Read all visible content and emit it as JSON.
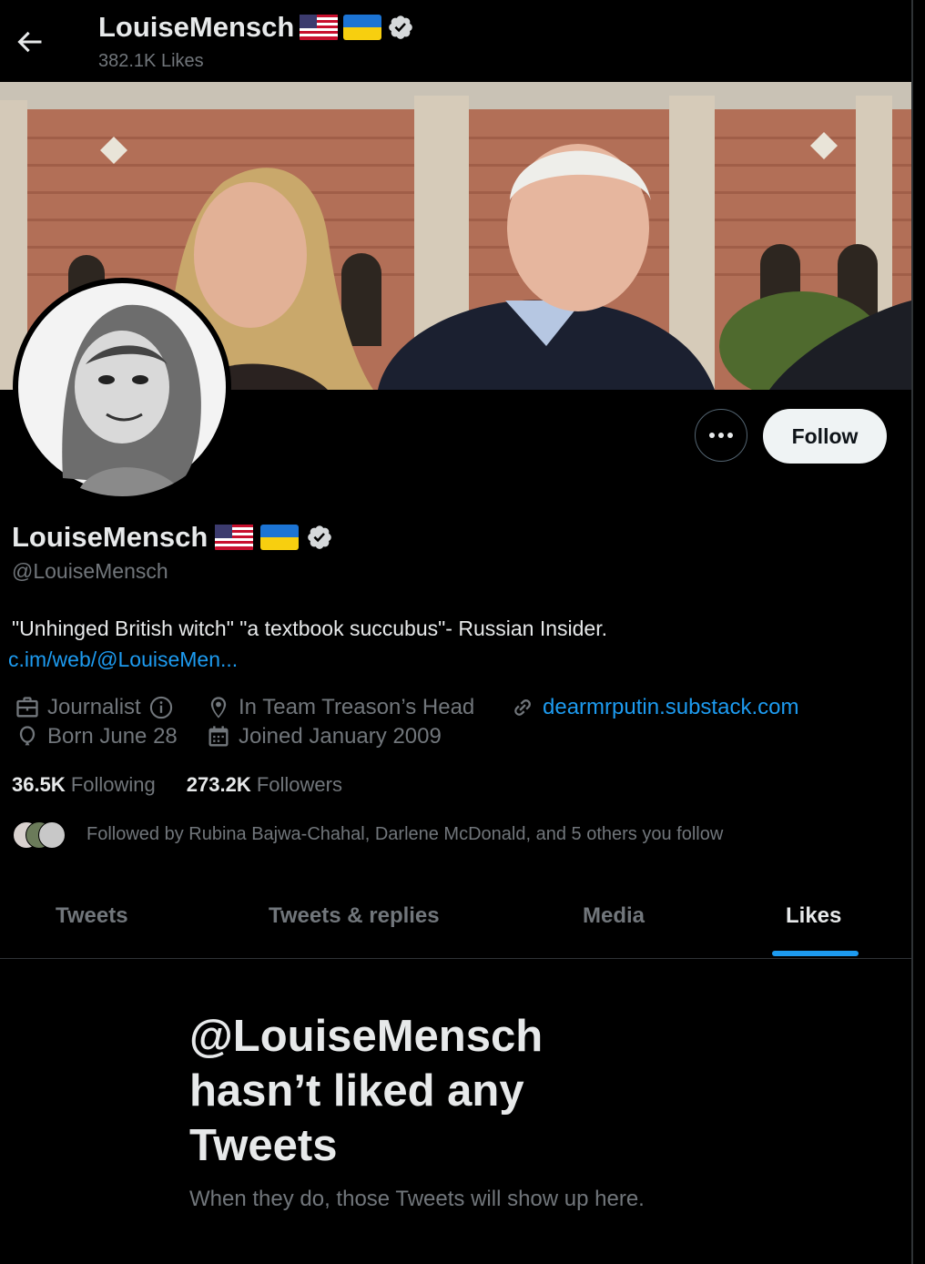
{
  "header": {
    "display_name": "LouiseMensch",
    "likes_count": "382.1K Likes"
  },
  "actions": {
    "follow_label": "Follow"
  },
  "profile": {
    "display_name": "LouiseMensch",
    "handle": "@LouiseMensch",
    "bio": "\"Unhinged British witch\" \"a textbook succubus\"- Russian Insider.",
    "bio_link": "c.im/web/@LouiseMen...",
    "profession": "Journalist",
    "location": "In Team Treason’s Head",
    "website": "dearmrputin.substack.com",
    "birthday": "Born June 28",
    "joined": "Joined January 2009"
  },
  "stats": {
    "following_count": "36.5K",
    "following_label": "Following",
    "followers_count": "273.2K",
    "followers_label": "Followers"
  },
  "followed_by": "Followed by Rubina Bajwa-Chahal, Darlene McDonald, and 5 others you follow",
  "tabs": [
    {
      "label": "Tweets",
      "active": false
    },
    {
      "label": "Tweets & replies",
      "active": false
    },
    {
      "label": "Media",
      "active": false
    },
    {
      "label": "Likes",
      "active": true
    }
  ],
  "empty_state": {
    "title": "@LouiseMensch hasn’t liked any Tweets",
    "subtitle": "When they do, those Tweets will show up here."
  },
  "colors": {
    "background": "#000000",
    "accent": "#1d9bf0",
    "text_primary": "#e7e9ea",
    "text_secondary": "#71767b",
    "follow_button_bg": "#eff3f4"
  },
  "icons": [
    "back-arrow-icon",
    "us-flag-icon",
    "ukraine-flag-icon",
    "verified-badge-icon",
    "more-icon",
    "briefcase-icon",
    "info-icon",
    "location-icon",
    "link-icon",
    "balloon-icon",
    "calendar-icon"
  ]
}
